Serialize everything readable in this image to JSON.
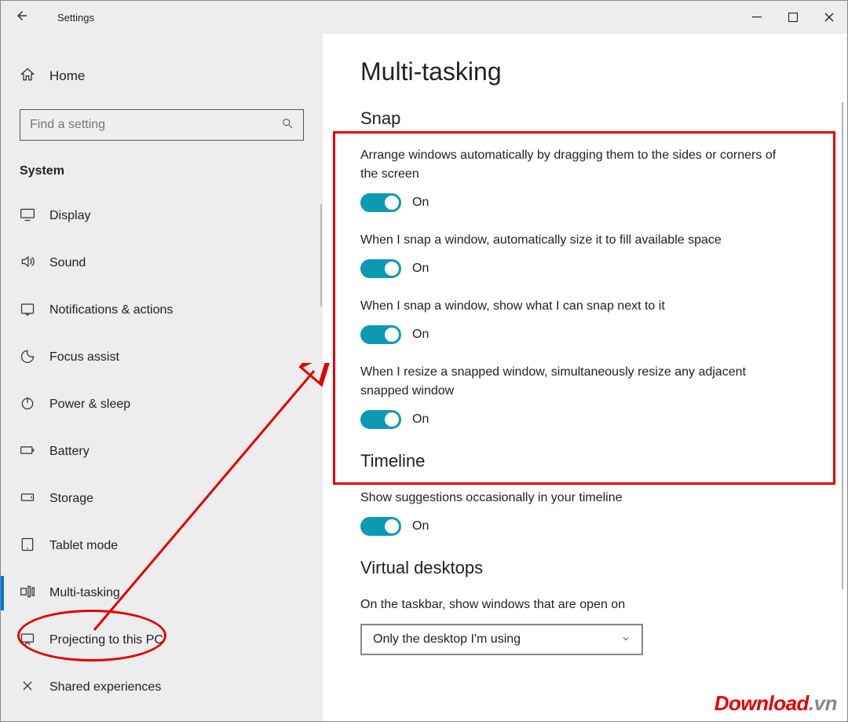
{
  "titlebar": {
    "title": "Settings"
  },
  "sidebar": {
    "home_label": "Home",
    "search_placeholder": "Find a setting",
    "category_label": "System",
    "items": [
      {
        "label": "Display"
      },
      {
        "label": "Sound"
      },
      {
        "label": "Notifications & actions"
      },
      {
        "label": "Focus assist"
      },
      {
        "label": "Power & sleep"
      },
      {
        "label": "Battery"
      },
      {
        "label": "Storage"
      },
      {
        "label": "Tablet mode"
      },
      {
        "label": "Multi-tasking"
      },
      {
        "label": "Projecting to this PC"
      },
      {
        "label": "Shared experiences"
      }
    ]
  },
  "main": {
    "page_title": "Multi-tasking",
    "snap": {
      "title": "Snap",
      "s1": {
        "desc": "Arrange windows automatically by dragging them to the sides or corners of the screen",
        "state": "On"
      },
      "s2": {
        "desc": "When I snap a window, automatically size it to fill available space",
        "state": "On"
      },
      "s3": {
        "desc": "When I snap a window, show what I can snap next to it",
        "state": "On"
      },
      "s4": {
        "desc": "When I resize a snapped window, simultaneously resize any adjacent snapped window",
        "state": "On"
      }
    },
    "timeline": {
      "title": "Timeline",
      "s1": {
        "desc": "Show suggestions occasionally in your timeline",
        "state": "On"
      }
    },
    "virtual": {
      "title": "Virtual desktops",
      "s1": {
        "desc": "On the taskbar, show windows that are open on",
        "value": "Only the desktop I'm using"
      }
    }
  },
  "watermark": {
    "main": "Download",
    "suffix": ".vn"
  },
  "colors": {
    "accent": "#0c9ab2",
    "annotation": "#e40000"
  }
}
